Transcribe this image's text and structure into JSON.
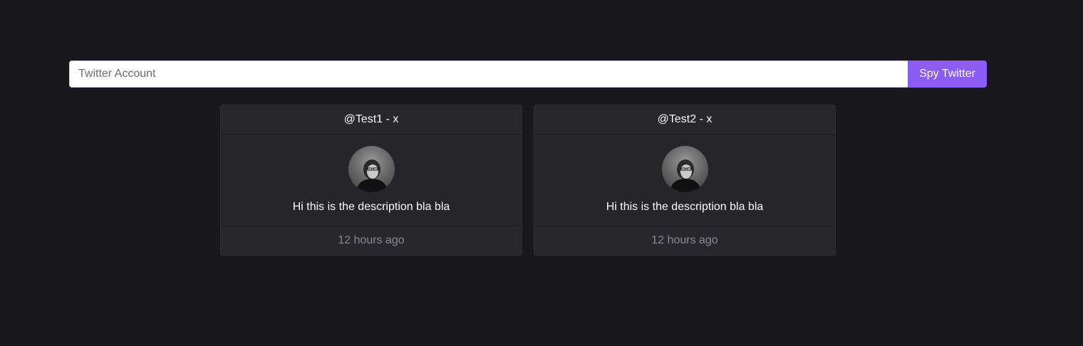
{
  "search": {
    "placeholder": "Twitter Account",
    "value": "",
    "button_label": "Spy Twitter"
  },
  "colors": {
    "background": "#1a181e",
    "card": "#26252b",
    "accent": "#8b5cf6",
    "muted_text": "#8a8991"
  },
  "cards": [
    {
      "handle": "@Test1",
      "close": "x",
      "header": "@Test1 - x",
      "avatar_icon": "profile-photo",
      "description": "Hi this is the description bla bla",
      "time": "12 hours ago"
    },
    {
      "handle": "@Test2",
      "close": "x",
      "header": "@Test2 - x",
      "avatar_icon": "profile-photo",
      "description": "Hi this is the description bla bla",
      "time": "12 hours ago"
    }
  ]
}
